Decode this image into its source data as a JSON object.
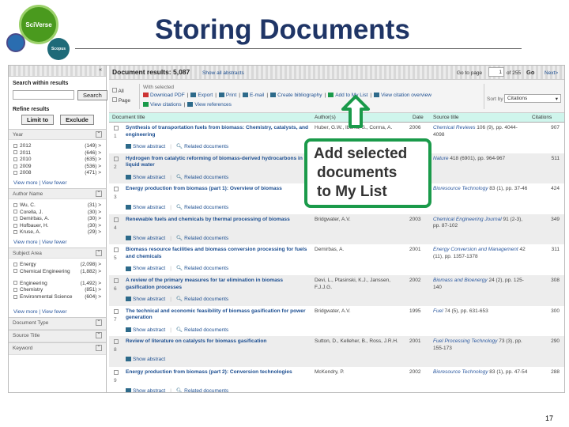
{
  "slide": {
    "title": "Storing Documents",
    "page_number": "17",
    "logo": {
      "sciverse": "SciVerse",
      "scopus": "Scopus"
    },
    "callout": [
      "Add selected",
      "documents",
      "to My List"
    ],
    "accent": "#1a9a4a"
  },
  "sidebar": {
    "search_label": "Search within results",
    "search_button": "Search",
    "search_value": "",
    "refine_label": "Refine results",
    "limit_button": "Limit to",
    "exclude_button": "Exclude",
    "view_more": "View more | View fewer",
    "facets": [
      {
        "name": "Year",
        "items": [
          {
            "label": "2012",
            "count": "(149) >"
          },
          {
            "label": "2011",
            "count": "(646) >"
          },
          {
            "label": "2010",
            "count": "(635) >"
          },
          {
            "label": "2009",
            "count": "(536) >"
          },
          {
            "label": "2008",
            "count": "(471) >"
          }
        ]
      },
      {
        "name": "Author Name",
        "items": [
          {
            "label": "Wu, C.",
            "count": "(31) >"
          },
          {
            "label": "Corella, J.",
            "count": "(30) >"
          },
          {
            "label": "Demirbas, A.",
            "count": "(30) >"
          },
          {
            "label": "Hofbauer, H.",
            "count": "(30) >"
          },
          {
            "label": "Kruse, A.",
            "count": "(29) >"
          }
        ]
      },
      {
        "name": "Subject Area",
        "items": [
          {
            "label": "Energy",
            "count": "(2,098) >"
          },
          {
            "label": "Chemical Engineering",
            "count": "(1,882) >"
          },
          {
            "label": "Engineering",
            "count": "(1,492) >"
          },
          {
            "label": "Chemistry",
            "count": "(851) >"
          },
          {
            "label": "Environmental Science",
            "count": "(604) >"
          }
        ]
      }
    ],
    "collapsed": [
      "Document Type",
      "Source Title",
      "Keyword"
    ]
  },
  "main": {
    "results_label": "Document results: 5,087",
    "show_all": "Show all abstracts",
    "goto_label": "Go to page",
    "page": "1",
    "of_pages": "of 255",
    "go": "Go",
    "next": "Next>",
    "select_all": "All",
    "select_page": "Page",
    "with_selected": "With selected",
    "actions": [
      "Download PDF",
      "Export",
      "Print",
      "E-mail",
      "Create bibliography",
      "Add to My List",
      "View citation overview",
      "View citations",
      "View references"
    ],
    "sort_label": "Sort by",
    "sort_value": "Citations",
    "columns": [
      "Document title",
      "Author(s)",
      "Date",
      "Source title",
      "Citations"
    ],
    "show_abstract": "Show abstract",
    "related": "Related documents",
    "rows": [
      {
        "n": "1",
        "title": "Synthesis of transportation fuels from biomass: Chemistry, catalysts, and engineering",
        "authors": "Huber, G.W., Iborra, S., Corma, A.",
        "date": "2006",
        "source": "Chemical Reviews",
        "src_rest": " 106 (9), pp. 4044-4098",
        "cit": "907"
      },
      {
        "n": "2",
        "title": "Hydrogen from catalytic reforming of biomass-derived hydrocarbons in liquid water",
        "authors": "",
        "date": "",
        "source": "Nature",
        "src_rest": " 418 (6901), pp. 964-967",
        "cit": "511"
      },
      {
        "n": "3",
        "title": "Energy production from biomass (part 1): Overview of biomass",
        "authors": "",
        "date": "",
        "source": "Bioresource Technology",
        "src_rest": " 83 (1), pp. 37-46",
        "cit": "424"
      },
      {
        "n": "4",
        "title": "Renewable fuels and chemicals by thermal processing of biomass",
        "authors": "Bridgwater, A.V.",
        "date": "2003",
        "source": "Chemical Engineering Journal",
        "src_rest": " 91 (2-3), pp. 87-102",
        "cit": "349"
      },
      {
        "n": "5",
        "title": "Biomass resource facilities and biomass conversion processing for fuels and chemicals",
        "authors": "Demirbas, A.",
        "date": "2001",
        "source": "Energy Conversion and Management",
        "src_rest": " 42 (11), pp. 1357-1378",
        "cit": "311"
      },
      {
        "n": "6",
        "title": "A review of the primary measures for tar elimination in biomass gasification processes",
        "authors": "Devi, L., Ptasinski, K.J., Janssen, F.J.J.G.",
        "date": "2002",
        "source": "Biomass and Bioenergy",
        "src_rest": " 24 (2), pp. 125-140",
        "cit": "308"
      },
      {
        "n": "7",
        "title": "The technical and economic feasibility of biomass gasification for power generation",
        "authors": "Bridgwater, A.V.",
        "date": "1995",
        "source": "Fuel",
        "src_rest": " 74 (5), pp. 631-653",
        "cit": "300"
      },
      {
        "n": "8",
        "title": "Review of literature on catalysts for biomass gasification",
        "authors": "Sutton, D., Kelleher, B., Ross, J.R.H.",
        "date": "2001",
        "source": "Fuel Processing Technology",
        "src_rest": " 73 (3), pp. 155-173",
        "cit": "290"
      },
      {
        "n": "9",
        "title": "Energy production from biomass (part 2): Conversion technologies",
        "authors": "McKendry, P.",
        "date": "2002",
        "source": "Bioresource Technology",
        "src_rest": " 83 (1), pp. 47-54",
        "cit": "288"
      }
    ]
  }
}
